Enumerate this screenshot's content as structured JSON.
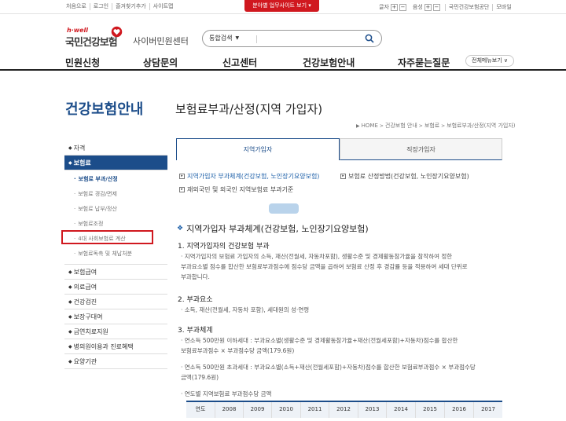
{
  "topbar": {
    "util_links": [
      "처음으로",
      "로그인",
      "즐겨찾기추가",
      "사이트맵"
    ],
    "red_tab": "분야별 업무사이트 보기 ▾",
    "font_label": "글자",
    "font_plus": "+",
    "font_minus": "−",
    "sound_label": "음성",
    "sound_plus": "+",
    "sound_minus": "−",
    "right_links": [
      "국민건강보험공단",
      "모바일"
    ]
  },
  "header": {
    "logo_tagline": "h·well",
    "logo_main": "국민건강보험",
    "logo_sub": "사이버민원센터",
    "search_select": "통합검색",
    "search_placeholder": ""
  },
  "gnb": {
    "items": [
      "민원신청",
      "상담문의",
      "신고센터",
      "건강보험안내",
      "자주묻는질문"
    ],
    "all_menu": "전체메뉴보기 ∨"
  },
  "lnb": {
    "title": "건강보험안내",
    "menu1": "자격",
    "menu2": "보험료",
    "sub": [
      "보험료 부과/산정",
      "보험료 경감/면제",
      "보험료 납부/정산",
      "보험료조정",
      "4대 사회보험료 계산",
      "보험료독촉 및 체납처분"
    ],
    "menu3": [
      "보험급여",
      "의료급여",
      "건강검진",
      "보장구대여",
      "금연치료지원",
      "병의원이용과 진료혜택",
      "요양기관"
    ]
  },
  "main": {
    "page_title": "보험료부과/산정(지역 가입자)",
    "breadcrumb": [
      "HOME",
      "건강보험 안내",
      "보험료",
      "보험료부과/산정(지역 가입자)"
    ],
    "tabs": [
      "지역가입자",
      "직장가입자"
    ],
    "links": [
      "지역가입자 부과체계(건강보험, 노인장기요양보험)",
      "보험료 산정방법(건강보험, 노인장기요양보험)",
      "재외국민 및 외국인 지역보험료 부과기준"
    ],
    "section_title": "지역가입자 부과체계(건강보험, 노인장기요양보험)",
    "h1": "1. 지역가입자의 건강보험 부과",
    "p1": [
      "· 지역가입자의 보험료 가입자의 소득, 재산(전월세, 자동차포함), 생활수준 및 경제활동참가율을 참작하여 정한",
      "  부과요소별 점수를 합산한 보험료부과점수에 점수당 금액을 곱하여 보험료 산정 후 경감률 등을 적용하여 세대 단위로",
      "  부과합니다."
    ],
    "h2": "2. 부과요소",
    "p2": "· 소득, 재산(전월세, 자동차 포함), 세대원의 성·연령",
    "h3": "3. 부과체계",
    "p3a": [
      "· 연소득 500만원 이하세대 : 부과요소별(생활수준 및 경제활동참가율+재산(전월세포함)+자동차)점수를 합산한",
      "  보험료부과점수 × 부과점수당 금액(179.6원)"
    ],
    "p3b": [
      "· 연소득 500만원 초과세대 : 부과요소별(소득+재산(전월세포함)+자동차)점수를 합산한 보험료부과점수 × 부과점수당",
      "  금액(179.6원)"
    ],
    "p3c": "· 연도별 지역보험료 부과점수당 금액",
    "table_header": [
      "연도",
      "2008",
      "2009",
      "2010",
      "2011",
      "2012",
      "2013",
      "2014",
      "2015",
      "2016",
      "2017"
    ]
  },
  "colors": {
    "brand_red": "#d0181f",
    "brand_blue": "#1c4d8a",
    "link_blue": "#1c5fa8"
  }
}
